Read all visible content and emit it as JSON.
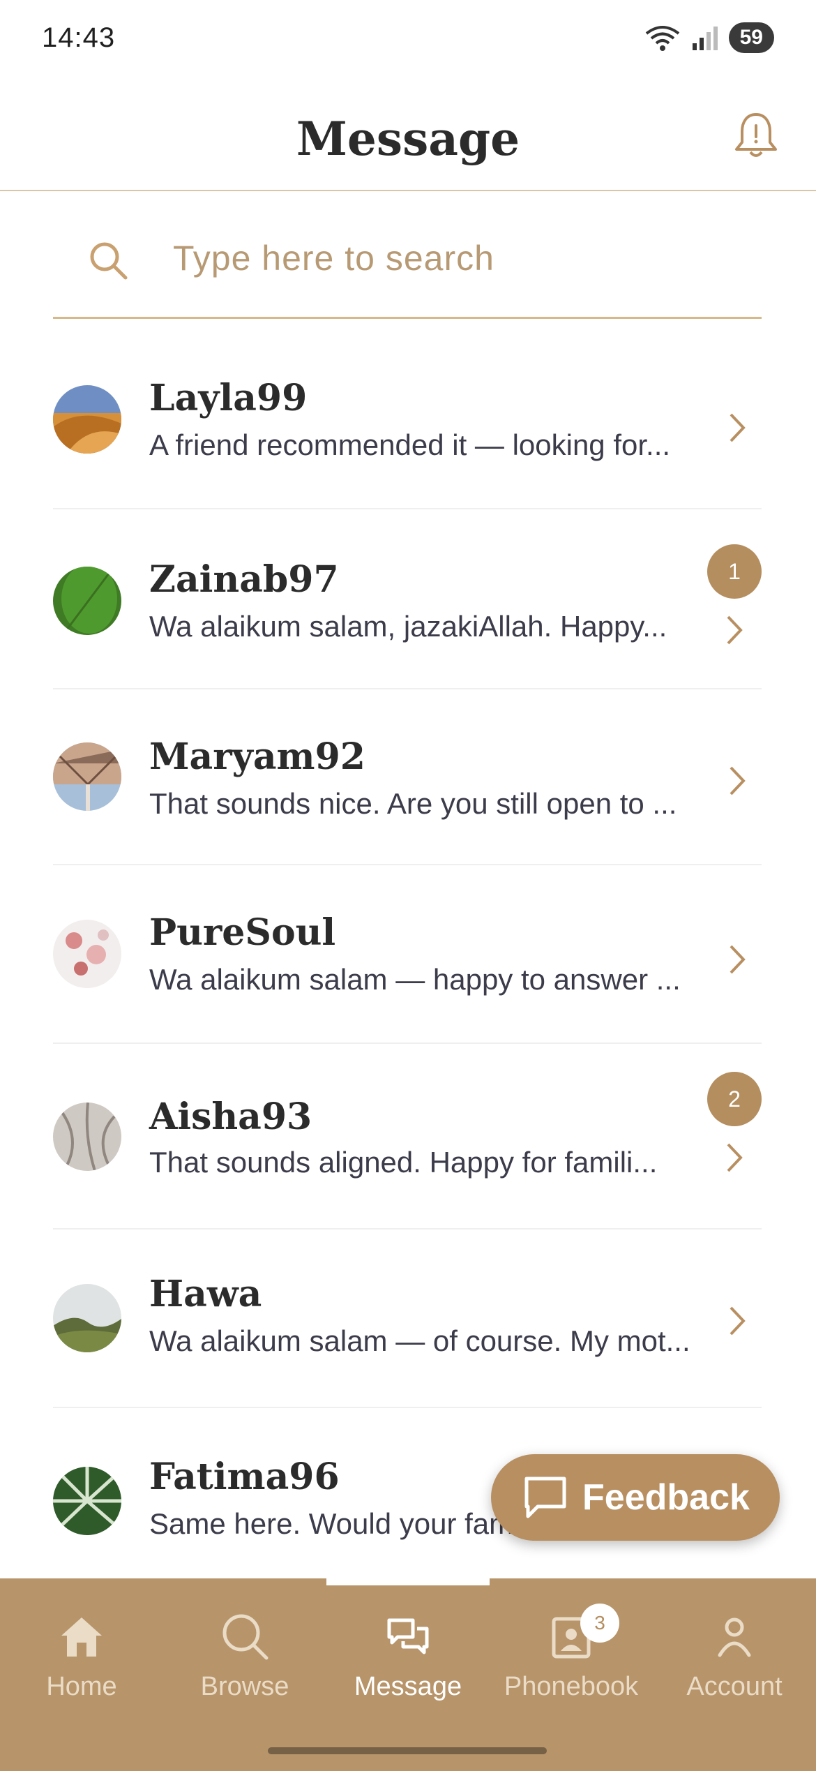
{
  "status_bar": {
    "time": "14:43",
    "battery": "59"
  },
  "header": {
    "title": "Message"
  },
  "search": {
    "placeholder": "Type here to search"
  },
  "conversations": [
    {
      "name": "Layla99",
      "preview": "A friend recommended it — looking for...",
      "unread": ""
    },
    {
      "name": "Zainab97",
      "preview": "Wa alaikum salam, jazakiAllah. Happy...",
      "unread": "1"
    },
    {
      "name": "Maryam92",
      "preview": "That sounds nice. Are you still open to ...",
      "unread": ""
    },
    {
      "name": "PureSoul",
      "preview": "Wa alaikum salam — happy to answer ...",
      "unread": ""
    },
    {
      "name": "Aisha93",
      "preview": "That sounds aligned. Happy for famili...",
      "unread": "2"
    },
    {
      "name": "Hawa",
      "preview": "Wa alaikum salam — of course. My mot...",
      "unread": ""
    },
    {
      "name": "Fatima96",
      "preview": "Same here. Would your family be ope...",
      "unread": ""
    }
  ],
  "feedback": {
    "label": "Feedback"
  },
  "nav": {
    "items": [
      {
        "label": "Home",
        "icon": "home-icon"
      },
      {
        "label": "Browse",
        "icon": "search-icon"
      },
      {
        "label": "Message",
        "icon": "chat-icon"
      },
      {
        "label": "Phonebook",
        "icon": "contact-book-icon",
        "badge": "3"
      },
      {
        "label": "Account",
        "icon": "person-icon"
      }
    ],
    "active": "Message"
  },
  "colors": {
    "accent": "#b88f61",
    "nav_bg": "#b79469",
    "divider": "#d8c7a7"
  }
}
